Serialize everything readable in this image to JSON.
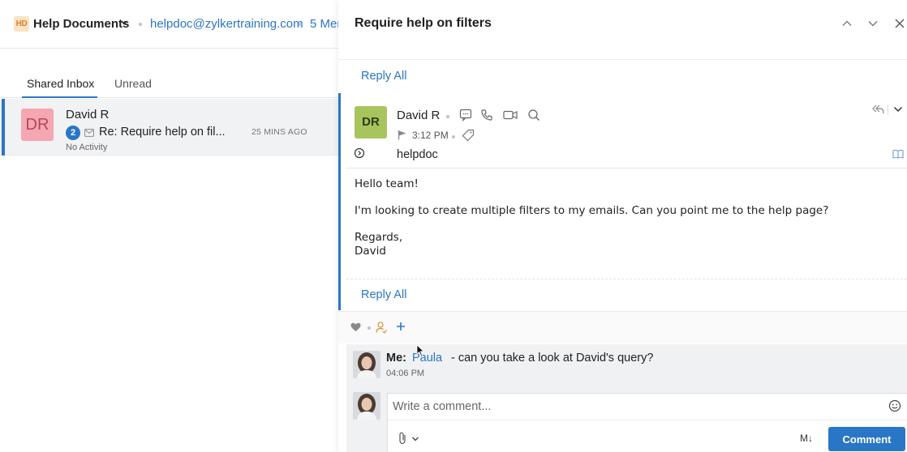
{
  "header": {
    "app_logo": "HD",
    "app_name": "Help Documents",
    "inbox_email": "helpdoc@zylkertraining.com",
    "members": "5 Mem"
  },
  "tabs": [
    {
      "label": "Shared Inbox",
      "active": true
    },
    {
      "label": "Unread",
      "active": false
    }
  ],
  "conversation": {
    "avatar_initials": "DR",
    "sender": "David R",
    "count": "2",
    "subject": "Re: Require help on fil...",
    "time": "25 MINS AGO",
    "activity": "No Activity"
  },
  "detail": {
    "title": "Require help on filters",
    "reply_all_top": "Reply All",
    "reply_all_bottom": "Reply All",
    "message": {
      "avatar_initials": "DR",
      "sender": "David R",
      "time": "3:12 PM",
      "to": "helpdoc",
      "body": [
        "Hello team!",
        "I'm looking to create multiple filters to my emails. Can you point me to the help page?",
        "Regards,",
        "David"
      ]
    },
    "comment": {
      "author": "Me:",
      "mention": "Paula",
      "text": "- can you take a look at David's query?",
      "time": "04:06 PM"
    },
    "composer": {
      "placeholder": "Write a comment...",
      "markdown_label": "M↓",
      "submit_label": "Comment"
    }
  },
  "colors": {
    "accent": "#2a76c6",
    "avatar_left": "#f6a6b2",
    "avatar_right": "#a8c45c"
  }
}
